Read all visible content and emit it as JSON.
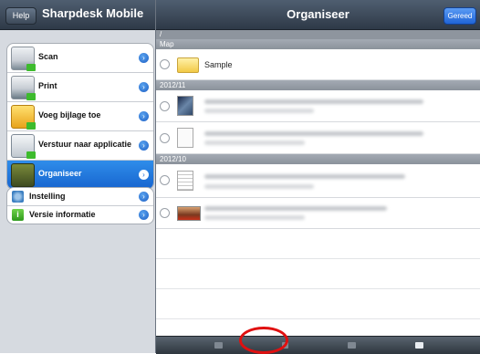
{
  "left_pane": {
    "help_label": "Help",
    "title": "Sharpdesk Mobile",
    "menu_main": [
      {
        "label": "Scan",
        "icon": "scan-icon"
      },
      {
        "label": "Print",
        "icon": "print-icon"
      },
      {
        "label": "Voeg bijlage toe",
        "icon": "attach-mail-icon"
      },
      {
        "label": "Verstuur naar applicatie",
        "icon": "send-to-app-icon"
      },
      {
        "label": "Organiseer",
        "icon": "organize-icon",
        "selected": true
      }
    ],
    "menu_settings": [
      {
        "label": "Instelling",
        "icon": "gear-icon"
      },
      {
        "label": "Versie informatie",
        "icon": "info-icon"
      }
    ],
    "disclosure_glyph": "›"
  },
  "right_pane": {
    "title": "Organiseer",
    "done_label": "Gereed",
    "path": "/",
    "sections": [
      {
        "header": "Map",
        "rows": [
          {
            "name": "Sample",
            "type": "folder"
          }
        ]
      },
      {
        "header": "2012/11",
        "rows": [
          {
            "type": "photo"
          },
          {
            "type": "sketch"
          }
        ]
      },
      {
        "header": "2012/10",
        "rows": [
          {
            "type": "document"
          },
          {
            "type": "wide-image"
          }
        ]
      }
    ],
    "toolbar": [
      "move-icon",
      "delete-icon",
      "copy-icon",
      "new-folder-icon"
    ]
  },
  "colors": {
    "accent": "#1b6bd6",
    "highlight": "#e01010",
    "navbar": "#3a4756"
  }
}
